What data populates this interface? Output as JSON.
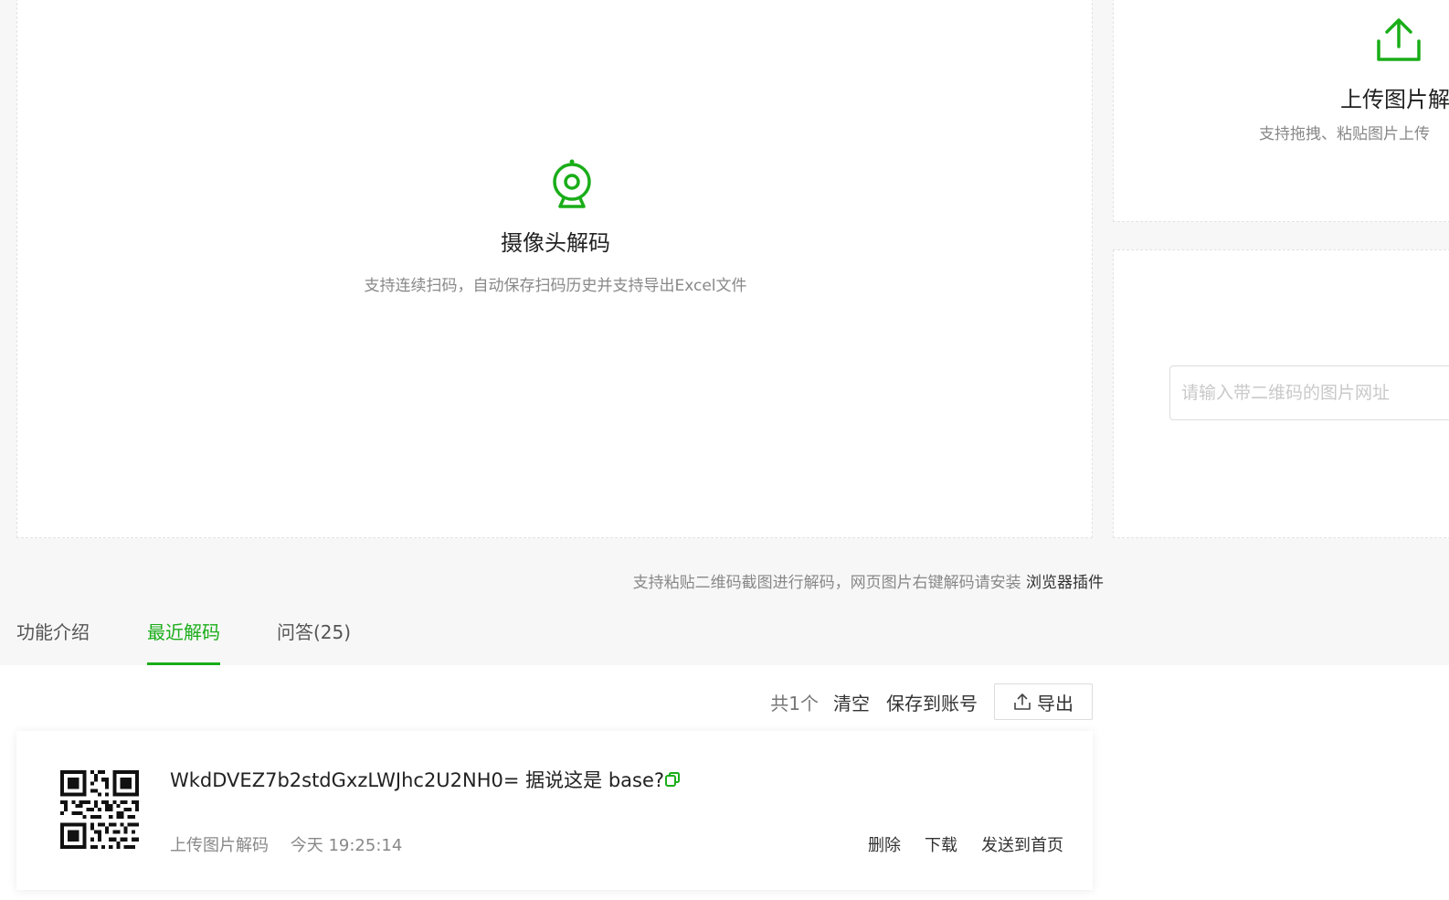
{
  "camera": {
    "title": "摄像头解码",
    "desc": "支持连续扫码，自动保存扫码历史并支持导出Excel文件"
  },
  "upload": {
    "title": "上传图片解码",
    "desc": "支持拖拽、粘贴图片上传"
  },
  "url_input": {
    "placeholder": "请输入带二维码的图片网址",
    "value": ""
  },
  "paste_hint": {
    "text": "支持粘贴二维码截图进行解码，网页图片右键解码请安装",
    "link": "浏览器插件"
  },
  "tabs": [
    {
      "label": "功能介绍",
      "active": false
    },
    {
      "label": "最近解码",
      "active": true
    },
    {
      "label": "问答(25)",
      "active": false
    }
  ],
  "toolbar": {
    "count": "共1个",
    "clear": "清空",
    "save": "保存到账号",
    "export": "导出"
  },
  "records": [
    {
      "content": "WkdDVEZ7b2stdGxzLWJhc2U2NH0= 据说这是 base?",
      "source": "上传图片解码",
      "time": "今天 19:25:14",
      "actions": [
        "删除",
        "下载",
        "发送到首页"
      ]
    }
  ],
  "colors": {
    "accent": "#1aad19",
    "background": "#f7f7f7"
  },
  "icons": {
    "camera": "webcam-icon",
    "upload": "upload-icon",
    "copy": "copy-icon",
    "export": "export-icon"
  }
}
